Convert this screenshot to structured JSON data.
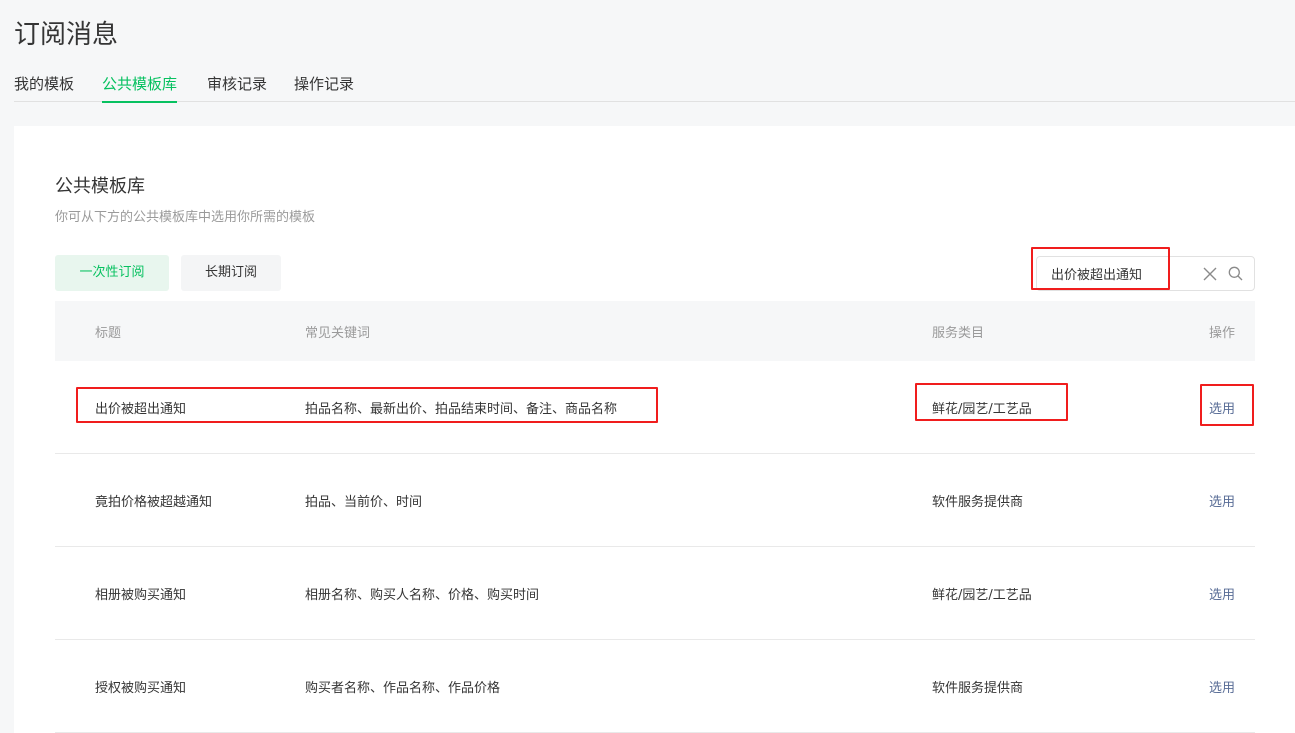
{
  "page": {
    "title": "订阅消息"
  },
  "tabs": [
    {
      "label": "我的模板",
      "active": false
    },
    {
      "label": "公共模板库",
      "active": true
    },
    {
      "label": "审核记录",
      "active": false
    },
    {
      "label": "操作记录",
      "active": false
    }
  ],
  "section": {
    "title": "公共模板库",
    "description": "你可从下方的公共模板库中选用你所需的模板"
  },
  "subscription_types": [
    {
      "label": "一次性订阅",
      "active": true
    },
    {
      "label": "长期订阅",
      "active": false
    }
  ],
  "search": {
    "value": "出价被超出通知",
    "clear_icon": "close-icon",
    "search_icon": "search-icon"
  },
  "table": {
    "headers": {
      "title": "标题",
      "keywords": "常见关键词",
      "category": "服务类目",
      "action": "操作"
    },
    "rows": [
      {
        "title": "出价被超出通知",
        "keywords": "拍品名称、最新出价、拍品结束时间、备注、商品名称",
        "category": "鲜花/园艺/工艺品",
        "action": "选用"
      },
      {
        "title": "竟拍价格被超越通知",
        "keywords": "拍品、当前价、时间",
        "category": "软件服务提供商",
        "action": "选用"
      },
      {
        "title": "相册被购买通知",
        "keywords": "相册名称、购买人名称、价格、购买时间",
        "category": "鲜花/园艺/工艺品",
        "action": "选用"
      },
      {
        "title": "授权被购买通知",
        "keywords": "购买者名称、作品名称、作品价格",
        "category": "软件服务提供商",
        "action": "选用"
      }
    ]
  },
  "colors": {
    "accent": "#07c160",
    "link": "#576b95",
    "highlight": "#f01d1d"
  }
}
